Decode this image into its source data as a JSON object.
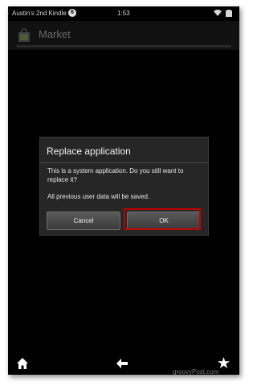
{
  "status_bar": {
    "device_name": "Austin's 2nd Kindle",
    "notification_count": "6",
    "time": "1:53",
    "icons": [
      "wifi-icon",
      "battery-icon"
    ]
  },
  "header": {
    "title": "Market",
    "icon": "shopping-bag-icon"
  },
  "dialog": {
    "title": "Replace application",
    "message": "This is a system application. Do you still want to replace it?",
    "note": "All previous user data will be saved.",
    "cancel_label": "Cancel",
    "ok_label": "OK"
  },
  "nav_bar": {
    "icons": [
      "home-icon",
      "back-icon",
      "star-icon"
    ]
  },
  "watermark": "groovyPost.com",
  "colors": {
    "highlight": "#c00000",
    "dialog_bg": "#262626",
    "screen_bg": "#000000"
  }
}
